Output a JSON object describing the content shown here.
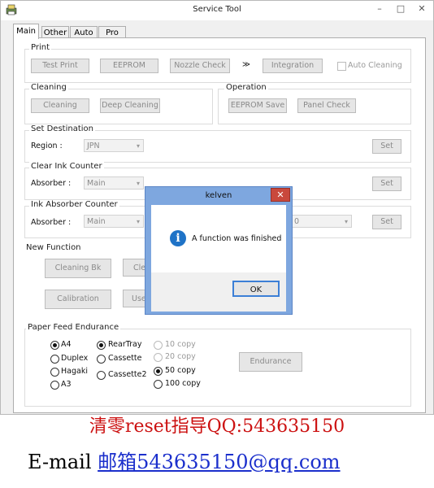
{
  "window": {
    "title": "Service Tool",
    "minimize": "–",
    "maximize": "□",
    "close": "✕"
  },
  "tabs": [
    "Main",
    "Other",
    "Auto",
    "Pro"
  ],
  "print": {
    "label": "Print",
    "buttons": [
      "Test Print",
      "EEPROM",
      "Nozzle Check",
      "Integration"
    ],
    "arrows": "≫",
    "auto_cleaning": "Auto Cleaning"
  },
  "cleaning": {
    "label": "Cleaning",
    "buttons": [
      "Cleaning",
      "Deep Cleaning"
    ]
  },
  "operation": {
    "label": "Operation",
    "buttons": [
      "EEPROM Save",
      "Panel Check"
    ]
  },
  "set_destination": {
    "label": "Set Destination",
    "field_label": "Region :",
    "value": "JPN",
    "set": "Set"
  },
  "clear_ink_counter": {
    "label": "Clear Ink Counter",
    "field_label": "Absorber :",
    "value": "Main",
    "set": "Set"
  },
  "ink_absorber_counter": {
    "label": "Ink Absorber Counter",
    "field_label": "Absorber :",
    "value": "Main",
    "value2": "0",
    "set": "Set"
  },
  "new_function": {
    "label": "New Function",
    "buttons": [
      "Cleaning Bk",
      "Cle",
      "Calibration",
      "Use"
    ]
  },
  "paper_feed": {
    "label": "Paper Feed Endurance",
    "sizes": [
      {
        "label": "A4",
        "selected": true
      },
      {
        "label": "Duplex",
        "selected": false
      },
      {
        "label": "Hagaki",
        "selected": false
      },
      {
        "label": "A3",
        "selected": false
      }
    ],
    "trays": [
      {
        "label": "RearTray",
        "selected": true
      },
      {
        "label": "Cassette",
        "selected": false
      },
      {
        "label": "Cassette2",
        "selected": false
      }
    ],
    "copies": [
      {
        "label": "10 copy",
        "selected": false,
        "enabled": false
      },
      {
        "label": "20 copy",
        "selected": false,
        "enabled": false
      },
      {
        "label": "50 copy",
        "selected": true,
        "enabled": true
      },
      {
        "label": "100 copy",
        "selected": false,
        "enabled": true
      }
    ],
    "endurance": "Endurance"
  },
  "dialog": {
    "title": "kelven",
    "close": "✕",
    "icon": "i",
    "message": "A function was finished",
    "ok": "OK"
  },
  "watermark": {
    "line1": "清零reset指导QQ:543635150",
    "line2_prefix": "E-mail ",
    "line2_link": "邮箱543635150@qq.com"
  }
}
